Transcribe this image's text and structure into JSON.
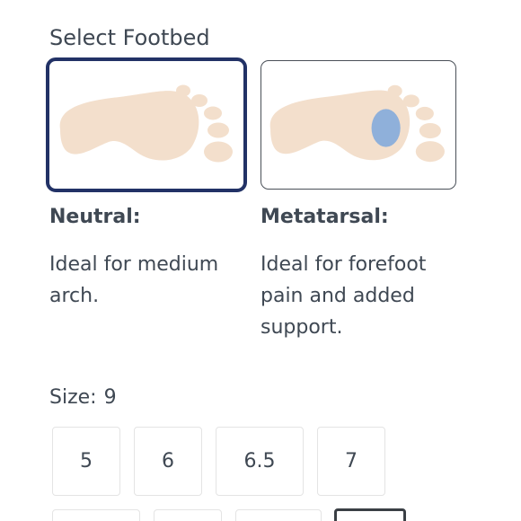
{
  "footbed": {
    "title": "Select Footbed",
    "options": [
      {
        "name": "Neutral:",
        "description": "Ideal for medium arch."
      },
      {
        "name": "Metatarsal:",
        "description": "Ideal for forefoot pain and added support."
      }
    ],
    "colors": {
      "foot": "#f3dfcc",
      "metatarsal_pad": "#8fb0da",
      "selected_border": "#223266"
    },
    "selected_index": 0
  },
  "size": {
    "label": "Size:",
    "value": "9",
    "options": [
      "5",
      "6",
      "6.5",
      "7"
    ]
  },
  "icons": [
    "foot-neutral-icon",
    "foot-metatarsal-icon"
  ]
}
